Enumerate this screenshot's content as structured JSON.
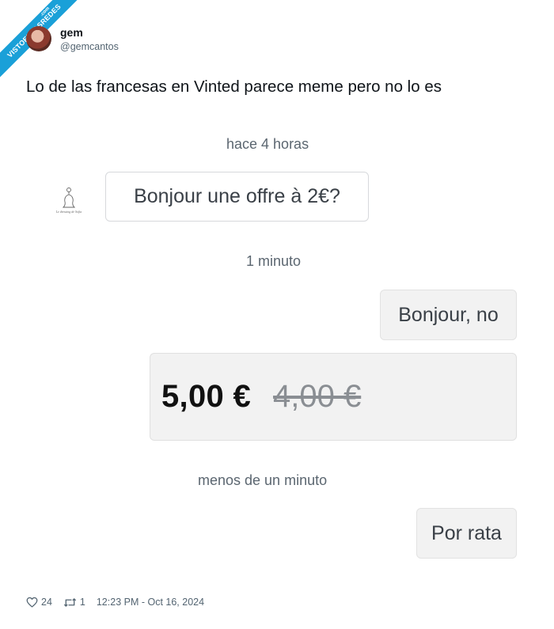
{
  "watermark": {
    "text": "VISTOENLASREDES",
    "sub": ".com"
  },
  "author": {
    "name": "gem",
    "handle": "@gemcantos"
  },
  "tweet": {
    "text": "Lo de las francesas en Vinted parece meme pero no lo es"
  },
  "chat": {
    "shop_logo_text": "Le dressing de Sofia",
    "time_1": "hace 4 horas",
    "msg_incoming": "Bonjour une offre à 2€?",
    "time_2": "1 minuto",
    "msg_reply_1": "Bonjour, no",
    "offer": {
      "new_price": "5,00 €",
      "old_price": "4,00 €"
    },
    "time_3": "menos de un minuto",
    "msg_reply_2": "Por rata"
  },
  "footer": {
    "likes": "24",
    "retweets": "1",
    "timestamp": "12:23 PM - Oct 16, 2024",
    "like_icon": "heart-icon",
    "retweet_icon": "retweet-icon"
  },
  "colors": {
    "ribbon": "#1aa0d8",
    "text": "#0f1419",
    "muted": "#536471"
  }
}
